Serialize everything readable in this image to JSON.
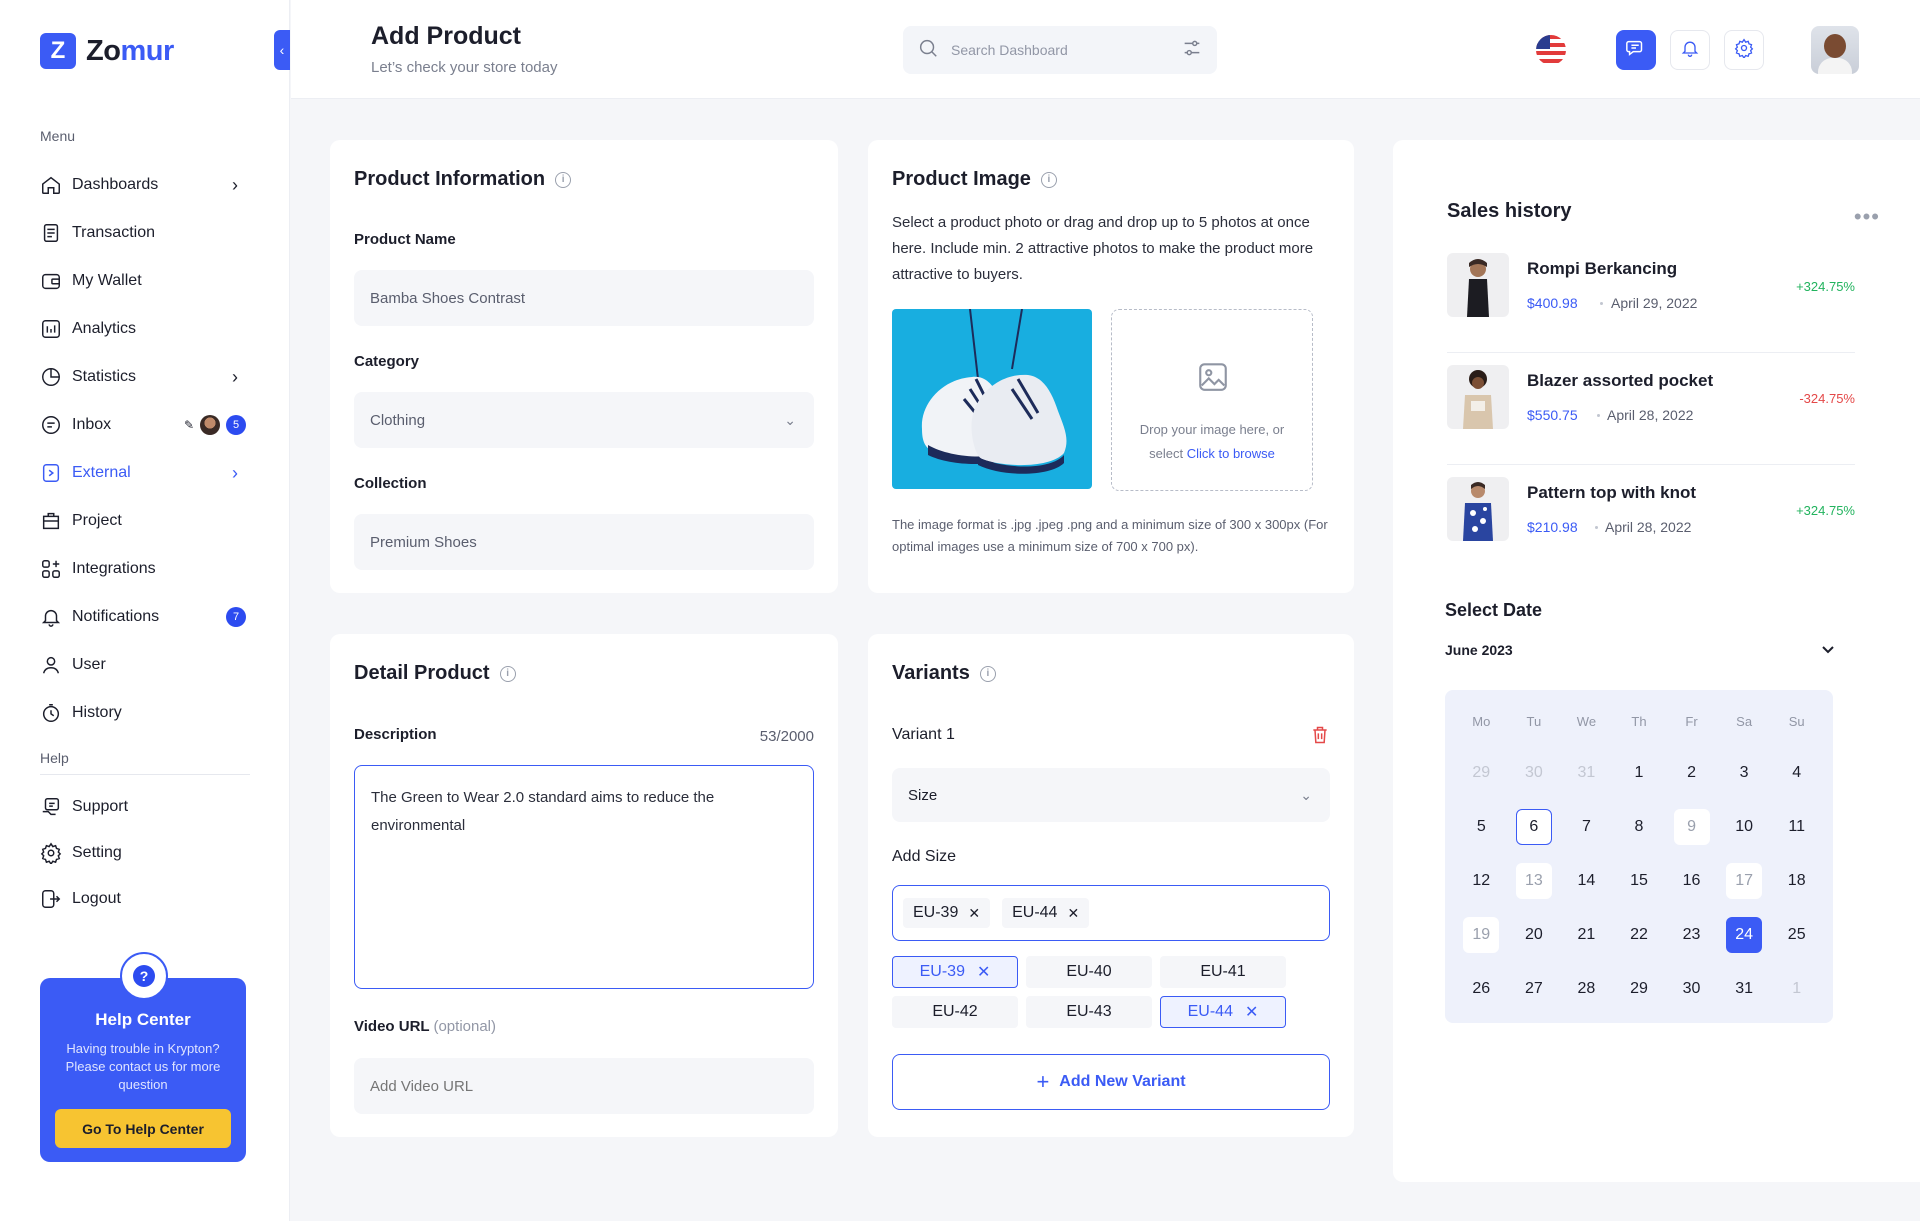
{
  "app": {
    "logo_letter": "Z",
    "logo_text_1": "Zo",
    "logo_text_2": "mur",
    "brand_color": "#3b5bf5"
  },
  "sidebar": {
    "menu_label": "Menu",
    "items": [
      {
        "label": "Dashboards",
        "icon": "home-icon"
      },
      {
        "label": "Transaction",
        "icon": "receipt-icon"
      },
      {
        "label": "My Wallet",
        "icon": "wallet-icon"
      },
      {
        "label": "Analytics",
        "icon": "analytics-icon"
      },
      {
        "label": "Statistics",
        "icon": "pie-chart-icon"
      },
      {
        "label": "Inbox",
        "icon": "inbox-icon",
        "badge": "5"
      },
      {
        "label": "External",
        "icon": "external-icon"
      },
      {
        "label": "Project",
        "icon": "project-icon"
      },
      {
        "label": "Integrations",
        "icon": "integrations-icon"
      },
      {
        "label": "Notifications",
        "icon": "bell-icon",
        "badge": "7"
      },
      {
        "label": "User",
        "icon": "user-icon"
      },
      {
        "label": "History",
        "icon": "history-icon"
      }
    ],
    "help_label": "Help",
    "help_items": [
      {
        "label": "Support",
        "icon": "support-icon"
      },
      {
        "label": "Setting",
        "icon": "gear-icon"
      },
      {
        "label": "Logout",
        "icon": "logout-icon"
      }
    ],
    "help_card": {
      "title": "Help Center",
      "text": "Having trouble in Krypton? Please contact us for more question",
      "button": "Go To Help Center"
    }
  },
  "header": {
    "title": "Add Product",
    "subtitle": "Let’s check your store today",
    "search_placeholder": "Search Dashboard"
  },
  "product_info": {
    "title": "Product Information",
    "name_label": "Product Name",
    "name_value": "Bamba Shoes Contrast",
    "category_label": "Category",
    "category_value": "Clothing",
    "collection_label": "Collection",
    "collection_value": "Premium Shoes"
  },
  "product_image": {
    "title": "Product Image",
    "description": "Select a product photo or drag and drop up to 5 photos at once here. Include min. 2 attractive photos to make the product more attractive to buyers.",
    "drop_text": "Drop your image here, or select",
    "drop_link": "Click to browse",
    "note": "The image format is .jpg .jpeg .png and a minimum size of 300 x 300px (For optimal images use a minimum size of 700 x 700 px)."
  },
  "detail_product": {
    "title": "Detail Product",
    "description_label": "Description",
    "counter": "53/2000",
    "description_value": "The Green to Wear 2.0 standard aims to reduce the environmental",
    "video_label": "Video URL",
    "video_optional": "(optional)",
    "video_placeholder": "Add Video URL"
  },
  "variants": {
    "title": "Variants",
    "variant_label": "Variant 1",
    "variant_type": "Size",
    "add_size_label": "Add Size",
    "selected_tags": [
      "EU-39",
      "EU-44"
    ],
    "sizes": [
      {
        "label": "EU-39",
        "selected": true
      },
      {
        "label": "EU-40",
        "selected": false
      },
      {
        "label": "EU-41",
        "selected": false
      },
      {
        "label": "EU-42",
        "selected": false
      },
      {
        "label": "EU-43",
        "selected": false
      },
      {
        "label": "EU-44",
        "selected": true
      }
    ],
    "add_button": "Add New Variant"
  },
  "sales_history": {
    "title": "Sales history",
    "items": [
      {
        "name": "Rompi Berkancing",
        "price": "$400.98",
        "date": "April 29, 2022",
        "change": "+324.75%",
        "trend": "up"
      },
      {
        "name": "Blazer assorted pocket",
        "price": "$550.75",
        "date": "April 28, 2022",
        "change": "-324.75%",
        "trend": "down"
      },
      {
        "name": "Pattern top with knot",
        "price": "$210.98",
        "date": "April 28, 2022",
        "change": "+324.75%",
        "trend": "up"
      }
    ]
  },
  "calendar": {
    "title": "Select Date",
    "month": "June 2023",
    "weekdays": [
      "Mo",
      "Tu",
      "We",
      "Th",
      "Fr",
      "Sa",
      "Su"
    ],
    "days": [
      {
        "d": "29",
        "s": "muted"
      },
      {
        "d": "30",
        "s": "muted"
      },
      {
        "d": "31",
        "s": "muted"
      },
      {
        "d": "1",
        "s": ""
      },
      {
        "d": "2",
        "s": ""
      },
      {
        "d": "3",
        "s": ""
      },
      {
        "d": "4",
        "s": ""
      },
      {
        "d": "5",
        "s": ""
      },
      {
        "d": "6",
        "s": "outline"
      },
      {
        "d": "7",
        "s": ""
      },
      {
        "d": "8",
        "s": ""
      },
      {
        "d": "9",
        "s": "soft"
      },
      {
        "d": "10",
        "s": ""
      },
      {
        "d": "11",
        "s": ""
      },
      {
        "d": "12",
        "s": ""
      },
      {
        "d": "13",
        "s": "soft"
      },
      {
        "d": "14",
        "s": ""
      },
      {
        "d": "15",
        "s": ""
      },
      {
        "d": "16",
        "s": ""
      },
      {
        "d": "17",
        "s": "soft"
      },
      {
        "d": "18",
        "s": ""
      },
      {
        "d": "19",
        "s": "soft"
      },
      {
        "d": "20",
        "s": ""
      },
      {
        "d": "21",
        "s": ""
      },
      {
        "d": "22",
        "s": ""
      },
      {
        "d": "23",
        "s": ""
      },
      {
        "d": "24",
        "s": "selected"
      },
      {
        "d": "25",
        "s": ""
      },
      {
        "d": "26",
        "s": ""
      },
      {
        "d": "27",
        "s": ""
      },
      {
        "d": "28",
        "s": ""
      },
      {
        "d": "29",
        "s": ""
      },
      {
        "d": "30",
        "s": ""
      },
      {
        "d": "31",
        "s": ""
      },
      {
        "d": "1",
        "s": "muted"
      }
    ]
  }
}
